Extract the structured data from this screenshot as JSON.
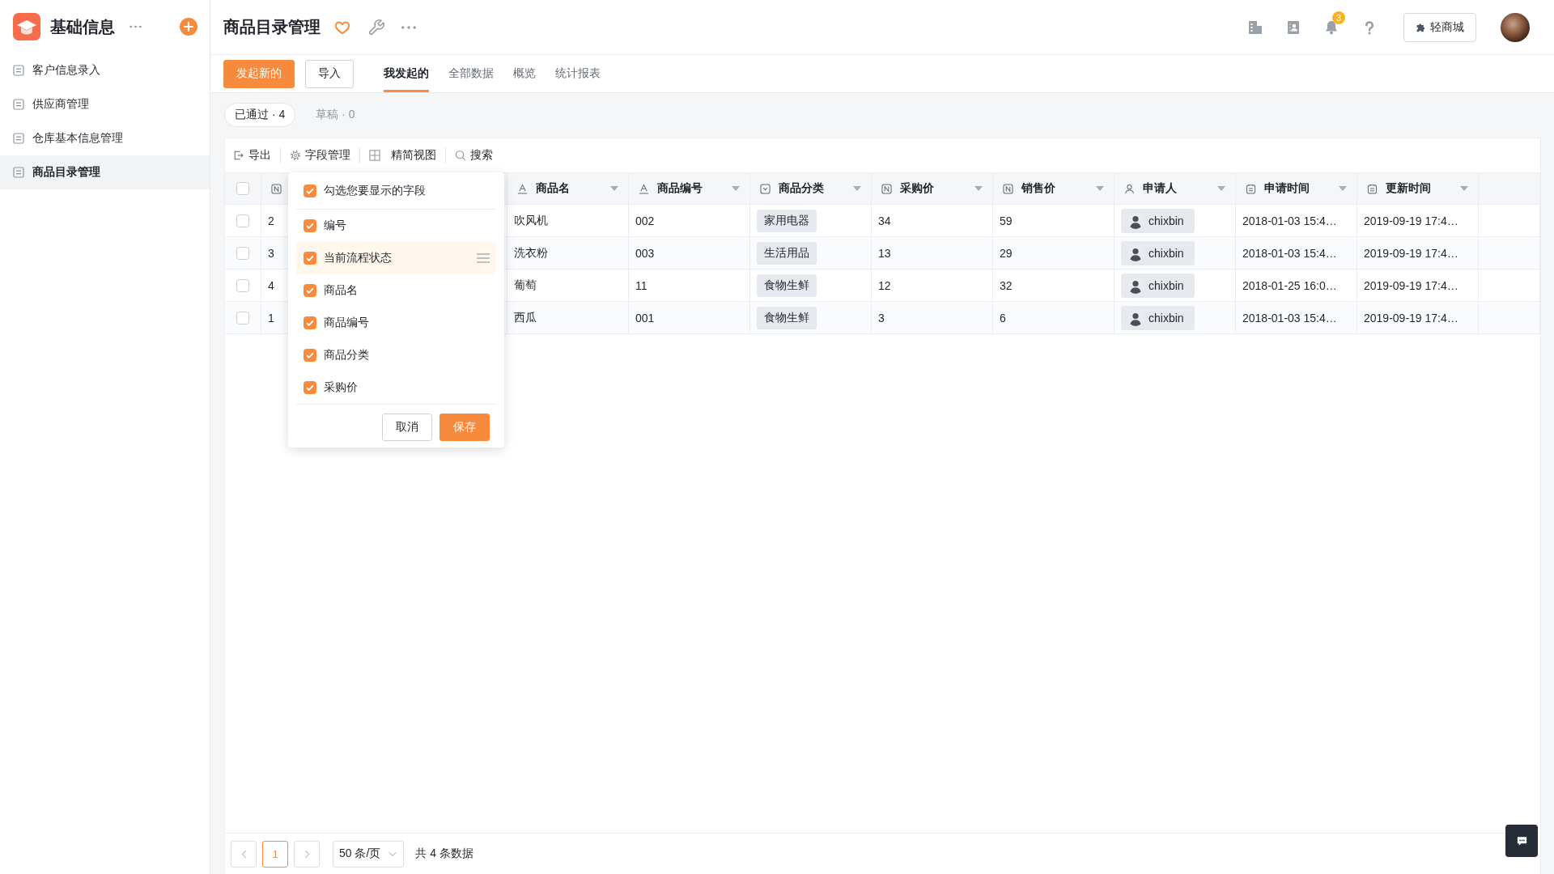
{
  "sidebar": {
    "title": "基础信息",
    "items": [
      {
        "label": "客户信息录入",
        "selected": false
      },
      {
        "label": "供应商管理",
        "selected": false
      },
      {
        "label": "仓库基本信息管理",
        "selected": false
      },
      {
        "label": "商品目录管理",
        "selected": true
      }
    ]
  },
  "header": {
    "title": "商品目录管理",
    "notifications": "3",
    "shop_button": "轻商城"
  },
  "actions": [
    {
      "kind": "primary",
      "label": "发起新的"
    },
    {
      "kind": "secondary",
      "label": "导入"
    }
  ],
  "tabs": [
    {
      "label": "我发起的",
      "selected": true
    },
    {
      "label": "全部数据",
      "selected": false
    },
    {
      "label": "概览",
      "selected": false
    },
    {
      "label": "统计报表",
      "selected": false
    }
  ],
  "filters": [
    {
      "label": "已通过 · 4",
      "selected": true
    },
    {
      "label": "草稿 · 0",
      "selected": false
    }
  ],
  "toolbar": [
    {
      "kind": "export",
      "label": "导出"
    },
    {
      "kind": "fields",
      "label": "字段管理"
    },
    {
      "kind": "view",
      "label": "精简视图"
    },
    {
      "kind": "search",
      "label": "搜索"
    }
  ],
  "table": {
    "all_checked": false,
    "columns": [
      {
        "kind": "number"
      },
      {
        "kind": "text",
        "label": "商品名"
      },
      {
        "kind": "text",
        "label": "商品编号"
      },
      {
        "kind": "select",
        "label": "商品分类"
      },
      {
        "kind": "number",
        "label": "采购价"
      },
      {
        "kind": "number",
        "label": "销售价"
      },
      {
        "kind": "person",
        "label": "申请人"
      },
      {
        "kind": "date",
        "label": "申请时间"
      },
      {
        "kind": "date",
        "label": "更新时间"
      }
    ],
    "rows": [
      {
        "checked": false,
        "cells": [
          "2",
          "吹风机",
          "002",
          "家用电器",
          "34",
          "59",
          "chixbin",
          "2018-01-03 15:4…",
          "2019-09-19 17:4…"
        ]
      },
      {
        "checked": false,
        "cells": [
          "3",
          "洗衣粉",
          "003",
          "生活用品",
          "13",
          "29",
          "chixbin",
          "2018-01-03 15:4…",
          "2019-09-19 17:4…"
        ]
      },
      {
        "checked": false,
        "cells": [
          "4",
          "葡萄",
          "11",
          "食物生鲜",
          "12",
          "32",
          "chixbin",
          "2018-01-25 16:0…",
          "2019-09-19 17:4…"
        ]
      },
      {
        "checked": false,
        "cells": [
          "1",
          "西瓜",
          "001",
          "食物生鲜",
          "3",
          "6",
          "chixbin",
          "2018-01-03 15:4…",
          "2019-09-19 17:4…"
        ]
      }
    ]
  },
  "field_picker": {
    "title": "勾选您要显示的字段",
    "all_checked": true,
    "fields": [
      {
        "label": "编号",
        "checked": true,
        "highlighted": false
      },
      {
        "label": "当前流程状态",
        "checked": true,
        "highlighted": true
      },
      {
        "label": "商品名",
        "checked": true,
        "highlighted": false
      },
      {
        "label": "商品编号",
        "checked": true,
        "highlighted": false
      },
      {
        "label": "商品分类",
        "checked": true,
        "highlighted": false
      },
      {
        "label": "采购价",
        "checked": true,
        "highlighted": false
      }
    ],
    "buttons": [
      {
        "kind": "cancel",
        "label": "取消"
      },
      {
        "kind": "save",
        "label": "保存"
      }
    ]
  },
  "pagination": {
    "pages": [
      {
        "label": "1",
        "selected": true
      }
    ],
    "page_size": "50 条/页",
    "total": "共 4 条数据"
  }
}
